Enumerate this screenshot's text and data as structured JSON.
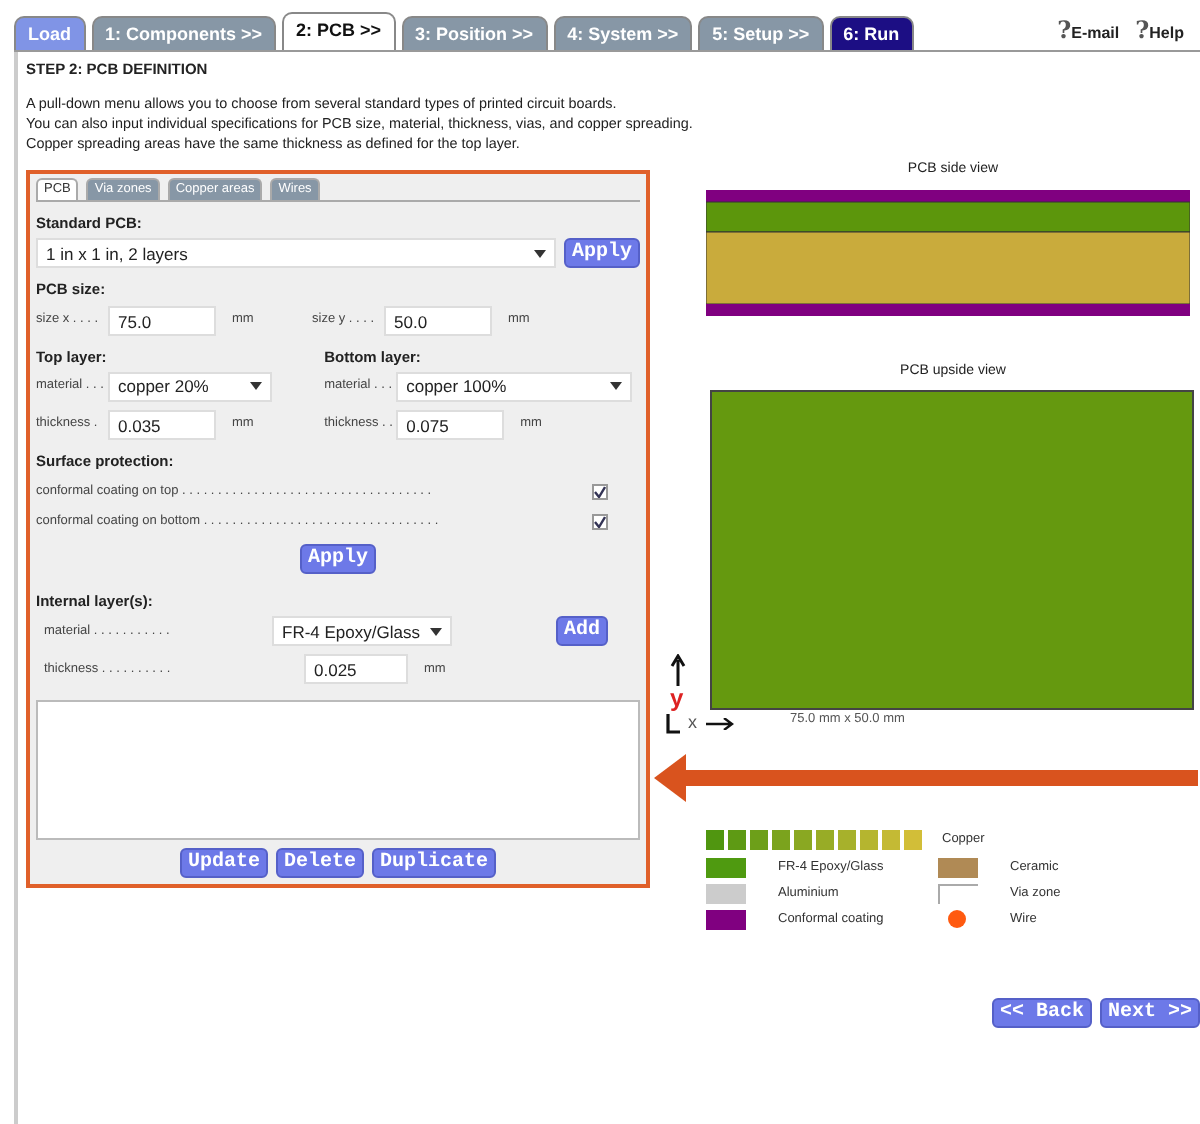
{
  "steps": [
    {
      "label": "Load",
      "kind": "load",
      "selected": false
    },
    {
      "label": "1: Components >>",
      "kind": "step",
      "selected": false
    },
    {
      "label": "2: PCB >>",
      "kind": "step",
      "selected": true
    },
    {
      "label": "3: Position >>",
      "kind": "step",
      "selected": false
    },
    {
      "label": "4: System >>",
      "kind": "step",
      "selected": false
    },
    {
      "label": "5: Setup >>",
      "kind": "step",
      "selected": false
    },
    {
      "label": "6: Run",
      "kind": "run",
      "selected": false
    }
  ],
  "top_links": [
    {
      "mark": "?",
      "label": "E-mail"
    },
    {
      "mark": "?",
      "label": "Help"
    }
  ],
  "heading": "STEP 2: PCB DEFINITION",
  "intro": [
    "A pull-down menu allows you to choose from several standard types of printed circuit boards.",
    "You can also input individual specifications for PCB size, material, thickness, vias, and copper spreading.",
    "Copper spreading areas have the same thickness as defined for the top layer."
  ],
  "panel_tabs": [
    {
      "label": "PCB",
      "selected": true
    },
    {
      "label": "Via zones",
      "selected": false
    },
    {
      "label": "Copper areas",
      "selected": false
    },
    {
      "label": "Wires",
      "selected": false
    }
  ],
  "standard_pcb": {
    "label": "Standard PCB:",
    "value": "1 in x 1 in, 2 layers",
    "button": "Apply"
  },
  "pcb_size": {
    "label": "PCB size:",
    "x_label": "size x . . . .",
    "x_value": "75.0",
    "y_label": "size y . . . .",
    "y_value": "50.0",
    "unit": "mm",
    "unit_y": "mm"
  },
  "layers": [
    {
      "title": "Top layer:",
      "material_label": "material . . .",
      "material": "copper 20%",
      "thickness_label": "thickness .",
      "thickness": "0.035",
      "unit": "mm"
    },
    {
      "title": "Bottom layer:",
      "material_label": "material . . .",
      "material": "copper 100%",
      "thickness_label": "thickness . .",
      "thickness": "0.075",
      "unit": "mm"
    }
  ],
  "surface": {
    "label": "Surface protection:",
    "options": [
      {
        "label": "conformal coating on top . . . . . . . . . . . . . . . . . . . . . . . . . . . . . . . . . . .",
        "checked": true
      },
      {
        "label": "conformal coating on bottom . . . . . . . . . . . . . . . . . . . . . . . . . . . . . . . . .",
        "checked": true
      }
    ],
    "button": "Apply"
  },
  "internal": {
    "label": "Internal layer(s):",
    "material_label": "material . . . . . . . . . . .",
    "material": "FR-4 Epoxy/Glass",
    "thickness_label": "thickness . . . . . . . . . .",
    "thickness": "0.025",
    "unit": "mm",
    "button": "Add"
  },
  "list_buttons": [
    "Update",
    "Delete",
    "Duplicate"
  ],
  "side_view": {
    "title": "PCB side view"
  },
  "upside_view": {
    "title": "PCB upside view",
    "caption": "75.0 mm x 50.0 mm",
    "y_axis": "y",
    "x_axis": "x"
  },
  "legend": {
    "copper_label": "Copper",
    "items": [
      {
        "label": "FR-4 Epoxy/Glass",
        "color": "#4f9a10",
        "kind": "swatch"
      },
      {
        "label": "Ceramic",
        "color": "#b08a55",
        "kind": "swatch"
      },
      {
        "label": "Aluminium",
        "color": "#cccccc",
        "kind": "swatch"
      },
      {
        "label": "Via zone",
        "color": "#ffffff",
        "kind": "outline"
      },
      {
        "label": "Conformal coating",
        "color": "#800080",
        "kind": "swatch"
      },
      {
        "label": "Wire",
        "color": "#ff5a10",
        "kind": "dot"
      }
    ]
  },
  "nav": [
    "<< Back",
    "Next >>"
  ]
}
